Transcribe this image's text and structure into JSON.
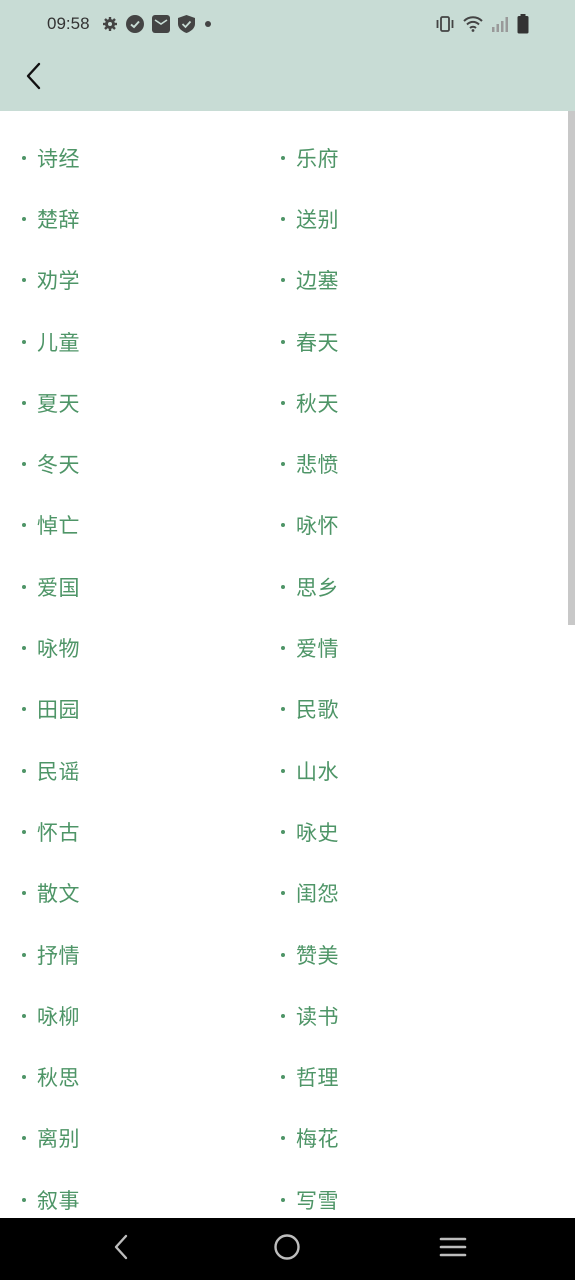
{
  "status_bar": {
    "time": "09:58",
    "left_icons": [
      "settings-icon",
      "check-circle-icon",
      "mail-icon",
      "shield-check-icon",
      "dot-icon"
    ],
    "right_icons": [
      "vibrate-icon",
      "wifi-icon",
      "signal-icon",
      "battery-icon"
    ]
  },
  "app_bar": {
    "back_icon": "back-arrow-icon"
  },
  "categories": [
    "诗经",
    "乐府",
    "楚辞",
    "送别",
    "劝学",
    "边塞",
    "儿童",
    "春天",
    "夏天",
    "秋天",
    "冬天",
    "悲愤",
    "悼亡",
    "咏怀",
    "爱国",
    "思乡",
    "咏物",
    "爱情",
    "田园",
    "民歌",
    "民谣",
    "山水",
    "怀古",
    "咏史",
    "散文",
    "闺怨",
    "抒情",
    "赞美",
    "咏柳",
    "读书",
    "秋思",
    "哲理",
    "离别",
    "梅花",
    "叙事",
    "写雪"
  ],
  "colors": {
    "header_bg": "#c8dcd5",
    "accent": "#4e9567",
    "nav_bg": "#000000"
  },
  "nav_bar": {
    "icons": [
      "nav-back-icon",
      "nav-home-icon",
      "nav-recents-icon"
    ]
  }
}
